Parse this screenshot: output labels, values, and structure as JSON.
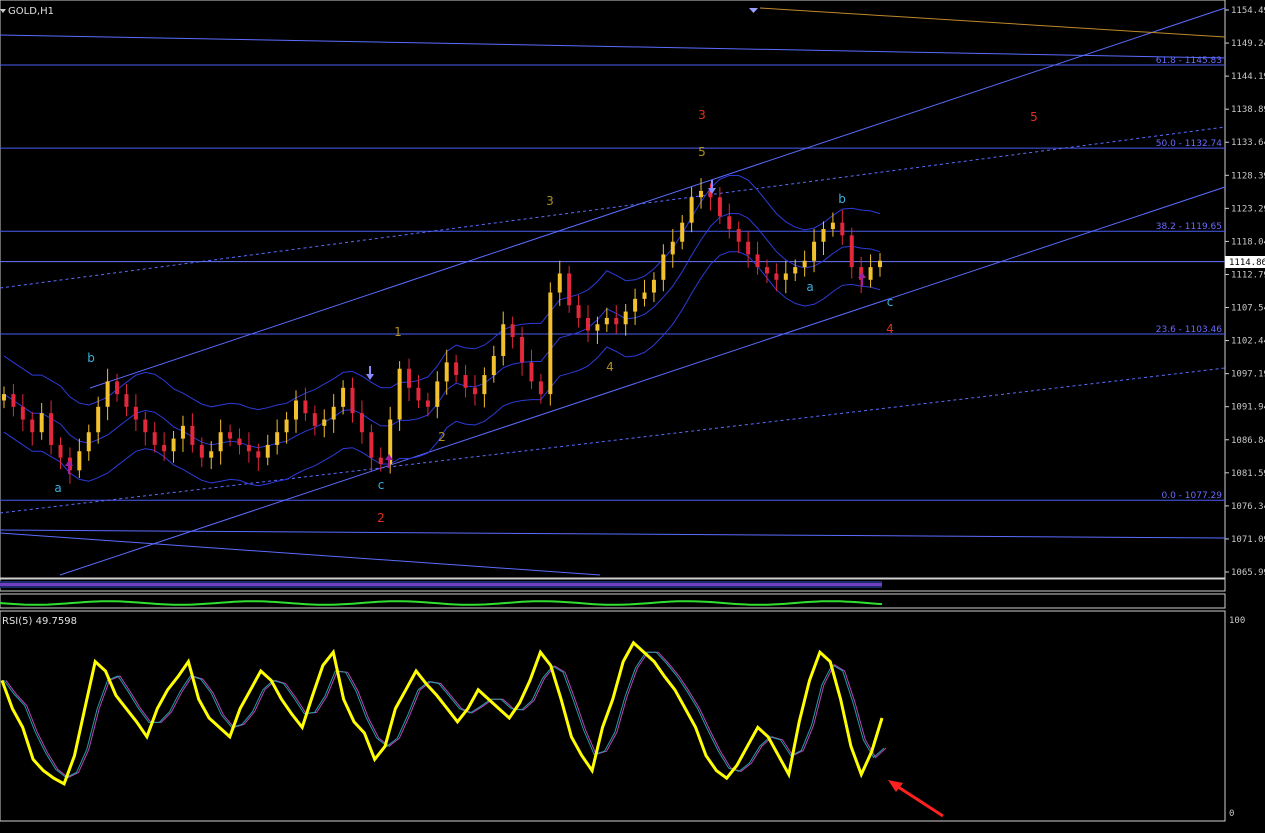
{
  "symbol_title": "GOLD,H1",
  "rsi_title": "RSI(5) 49.7598",
  "current_price_label": "1114.86",
  "colors": {
    "background": "#000000",
    "bull_candle": "#f2c12e",
    "bear_candle": "#e2283a",
    "channel": "#5a6cff",
    "fib": "#4a5cf0",
    "bollinger": "#2d3bd8",
    "rsi": "#ffff00",
    "rsi_signal_1": "#c040c0",
    "rsi_signal_2": "#20a0a0",
    "arrow": "#ff2020"
  },
  "chart_data": [
    {
      "type": "candlestick",
      "title": "GOLD,H1",
      "ylim": [
        1065.99,
        1154.49
      ],
      "yticks": [
        "1154.49",
        "1149.24",
        "1144.19",
        "1138.89",
        "1133.64",
        "1128.39",
        "1123.29",
        "1118.04",
        "1112.79",
        "1107.54",
        "1102.44",
        "1097.19",
        "1091.94",
        "1086.84",
        "1081.59",
        "1076.34",
        "1071.09",
        "1065.99"
      ],
      "last_price": "1114.86",
      "fib_levels": [
        {
          "label": "61.8 - 1145.83",
          "value": 1145.83
        },
        {
          "label": "50.0 - 1132.74",
          "value": 1132.74
        },
        {
          "label": "38.2 - 1119.65",
          "value": 1119.65
        },
        {
          "label": "23.6 - 1103.46",
          "value": 1103.46
        },
        {
          "label": "0.0 - 1077.29",
          "value": 1077.29
        }
      ],
      "wave_labels": [
        {
          "text": "3",
          "color": "#e03020"
        },
        {
          "text": "5",
          "color": "#e03020"
        },
        {
          "text": "5",
          "color": "#b09020"
        },
        {
          "text": "3",
          "color": "#b09020"
        },
        {
          "text": "b",
          "color": "#3ab0e0"
        },
        {
          "text": "a",
          "color": "#3ab0e0"
        },
        {
          "text": "c",
          "color": "#3ab0e0"
        },
        {
          "text": "4",
          "color": "#e03020"
        },
        {
          "text": "1",
          "color": "#b09020"
        },
        {
          "text": "b",
          "color": "#3ab0e0"
        },
        {
          "text": "4",
          "color": "#b09020"
        },
        {
          "text": "2",
          "color": "#b09020"
        },
        {
          "text": "a",
          "color": "#3ab0e0"
        },
        {
          "text": "c",
          "color": "#3ab0e0"
        },
        {
          "text": "2",
          "color": "#e03020"
        }
      ],
      "price_path": [
        1094,
        1092,
        1090,
        1088,
        1091,
        1086,
        1084,
        1082,
        1085,
        1088,
        1092,
        1096,
        1094,
        1092,
        1090,
        1088,
        1086,
        1085,
        1087,
        1089,
        1086,
        1084,
        1085,
        1088,
        1087,
        1086,
        1085,
        1084,
        1086,
        1088,
        1090,
        1093,
        1091,
        1089,
        1090,
        1092,
        1095,
        1091,
        1088,
        1084,
        1083,
        1090,
        1098,
        1095,
        1093,
        1092,
        1096,
        1099,
        1097,
        1095,
        1094,
        1097,
        1100,
        1105,
        1103,
        1099,
        1096,
        1094,
        1110,
        1113,
        1108,
        1106,
        1104,
        1105,
        1106,
        1105,
        1107,
        1109,
        1110,
        1112,
        1116,
        1118,
        1121,
        1125,
        1126,
        1125,
        1122,
        1120,
        1118,
        1116,
        1114,
        1113,
        1112,
        1113,
        1114,
        1115,
        1118,
        1120,
        1121,
        1119,
        1114,
        1112,
        1114,
        1115
      ]
    },
    {
      "type": "line",
      "title": "RSI(5) 49.7598",
      "ylim": [
        0,
        100
      ],
      "yticks": [
        "100",
        "0"
      ],
      "series": [
        {
          "values": [
            70,
            55,
            45,
            28,
            22,
            18,
            15,
            30,
            55,
            80,
            75,
            62,
            55,
            48,
            40,
            55,
            65,
            72,
            80,
            60,
            50,
            45,
            40,
            55,
            65,
            75,
            70,
            60,
            52,
            45,
            62,
            78,
            85,
            60,
            48,
            42,
            28,
            35,
            55,
            65,
            75,
            68,
            62,
            55,
            48,
            55,
            65,
            60,
            55,
            50,
            58,
            70,
            85,
            78,
            60,
            40,
            30,
            22,
            45,
            60,
            80,
            90,
            85,
            80,
            72,
            65,
            55,
            45,
            30,
            22,
            18,
            25,
            35,
            45,
            40,
            30,
            20,
            48,
            70,
            85,
            80,
            60,
            35,
            20,
            32,
            50
          ]
        }
      ]
    }
  ]
}
